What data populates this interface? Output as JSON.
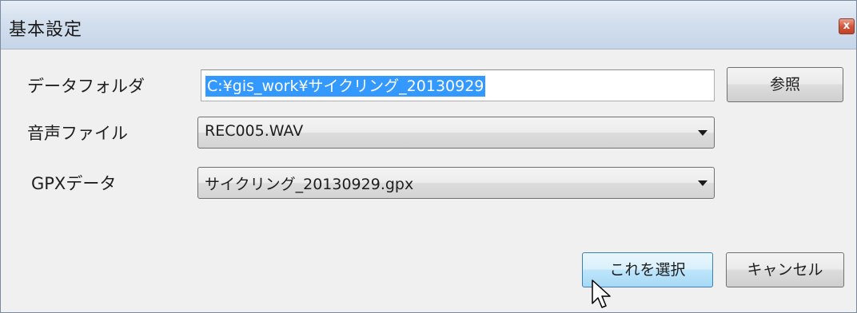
{
  "window": {
    "title": "基本設定",
    "close_glyph": "x"
  },
  "form": {
    "data_folder": {
      "label": "データフォルダ",
      "value": "C:¥gis_work¥サイクリング_20130929",
      "browse_label": "参照"
    },
    "audio_file": {
      "label": "音声ファイル",
      "selected": "REC005.WAV"
    },
    "gpx_data": {
      "label": "GPXデータ",
      "selected": "サイクリング_20130929.gpx"
    }
  },
  "buttons": {
    "select_label": "これを選択",
    "cancel_label": "キャンセル"
  },
  "icons": {
    "close": "close-icon",
    "dropdown": "chevron-down-icon",
    "cursor": "mouse-pointer-icon"
  },
  "colors": {
    "selection": "#3399ff",
    "titlebar": "#d3dfee",
    "close_button": "#c0432a",
    "hover_button": "#bee6fd"
  }
}
